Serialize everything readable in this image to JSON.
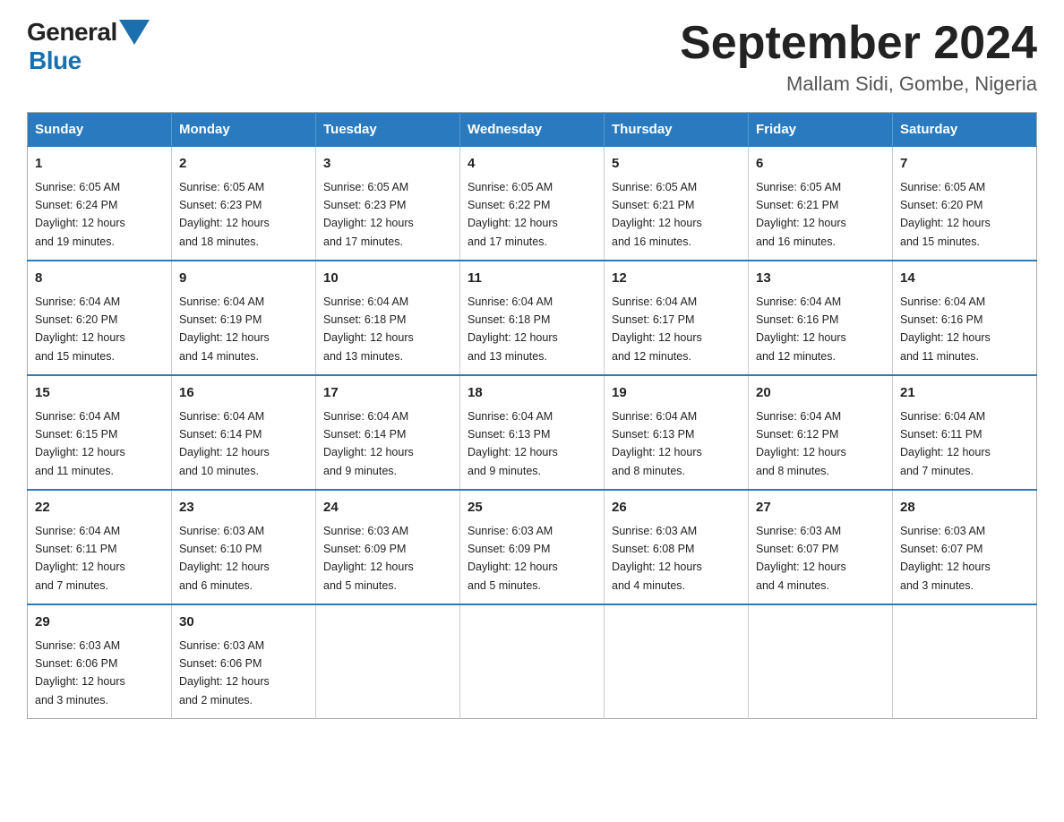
{
  "logo": {
    "text_general": "General",
    "text_blue": "Blue"
  },
  "title": {
    "month_year": "September 2024",
    "location": "Mallam Sidi, Gombe, Nigeria"
  },
  "weekdays": [
    "Sunday",
    "Monday",
    "Tuesday",
    "Wednesday",
    "Thursday",
    "Friday",
    "Saturday"
  ],
  "weeks": [
    [
      {
        "day": "1",
        "sunrise": "6:05 AM",
        "sunset": "6:24 PM",
        "daylight": "12 hours and 19 minutes."
      },
      {
        "day": "2",
        "sunrise": "6:05 AM",
        "sunset": "6:23 PM",
        "daylight": "12 hours and 18 minutes."
      },
      {
        "day": "3",
        "sunrise": "6:05 AM",
        "sunset": "6:23 PM",
        "daylight": "12 hours and 17 minutes."
      },
      {
        "day": "4",
        "sunrise": "6:05 AM",
        "sunset": "6:22 PM",
        "daylight": "12 hours and 17 minutes."
      },
      {
        "day": "5",
        "sunrise": "6:05 AM",
        "sunset": "6:21 PM",
        "daylight": "12 hours and 16 minutes."
      },
      {
        "day": "6",
        "sunrise": "6:05 AM",
        "sunset": "6:21 PM",
        "daylight": "12 hours and 16 minutes."
      },
      {
        "day": "7",
        "sunrise": "6:05 AM",
        "sunset": "6:20 PM",
        "daylight": "12 hours and 15 minutes."
      }
    ],
    [
      {
        "day": "8",
        "sunrise": "6:04 AM",
        "sunset": "6:20 PM",
        "daylight": "12 hours and 15 minutes."
      },
      {
        "day": "9",
        "sunrise": "6:04 AM",
        "sunset": "6:19 PM",
        "daylight": "12 hours and 14 minutes."
      },
      {
        "day": "10",
        "sunrise": "6:04 AM",
        "sunset": "6:18 PM",
        "daylight": "12 hours and 13 minutes."
      },
      {
        "day": "11",
        "sunrise": "6:04 AM",
        "sunset": "6:18 PM",
        "daylight": "12 hours and 13 minutes."
      },
      {
        "day": "12",
        "sunrise": "6:04 AM",
        "sunset": "6:17 PM",
        "daylight": "12 hours and 12 minutes."
      },
      {
        "day": "13",
        "sunrise": "6:04 AM",
        "sunset": "6:16 PM",
        "daylight": "12 hours and 12 minutes."
      },
      {
        "day": "14",
        "sunrise": "6:04 AM",
        "sunset": "6:16 PM",
        "daylight": "12 hours and 11 minutes."
      }
    ],
    [
      {
        "day": "15",
        "sunrise": "6:04 AM",
        "sunset": "6:15 PM",
        "daylight": "12 hours and 11 minutes."
      },
      {
        "day": "16",
        "sunrise": "6:04 AM",
        "sunset": "6:14 PM",
        "daylight": "12 hours and 10 minutes."
      },
      {
        "day": "17",
        "sunrise": "6:04 AM",
        "sunset": "6:14 PM",
        "daylight": "12 hours and 9 minutes."
      },
      {
        "day": "18",
        "sunrise": "6:04 AM",
        "sunset": "6:13 PM",
        "daylight": "12 hours and 9 minutes."
      },
      {
        "day": "19",
        "sunrise": "6:04 AM",
        "sunset": "6:13 PM",
        "daylight": "12 hours and 8 minutes."
      },
      {
        "day": "20",
        "sunrise": "6:04 AM",
        "sunset": "6:12 PM",
        "daylight": "12 hours and 8 minutes."
      },
      {
        "day": "21",
        "sunrise": "6:04 AM",
        "sunset": "6:11 PM",
        "daylight": "12 hours and 7 minutes."
      }
    ],
    [
      {
        "day": "22",
        "sunrise": "6:04 AM",
        "sunset": "6:11 PM",
        "daylight": "12 hours and 7 minutes."
      },
      {
        "day": "23",
        "sunrise": "6:03 AM",
        "sunset": "6:10 PM",
        "daylight": "12 hours and 6 minutes."
      },
      {
        "day": "24",
        "sunrise": "6:03 AM",
        "sunset": "6:09 PM",
        "daylight": "12 hours and 5 minutes."
      },
      {
        "day": "25",
        "sunrise": "6:03 AM",
        "sunset": "6:09 PM",
        "daylight": "12 hours and 5 minutes."
      },
      {
        "day": "26",
        "sunrise": "6:03 AM",
        "sunset": "6:08 PM",
        "daylight": "12 hours and 4 minutes."
      },
      {
        "day": "27",
        "sunrise": "6:03 AM",
        "sunset": "6:07 PM",
        "daylight": "12 hours and 4 minutes."
      },
      {
        "day": "28",
        "sunrise": "6:03 AM",
        "sunset": "6:07 PM",
        "daylight": "12 hours and 3 minutes."
      }
    ],
    [
      {
        "day": "29",
        "sunrise": "6:03 AM",
        "sunset": "6:06 PM",
        "daylight": "12 hours and 3 minutes."
      },
      {
        "day": "30",
        "sunrise": "6:03 AM",
        "sunset": "6:06 PM",
        "daylight": "12 hours and 2 minutes."
      },
      null,
      null,
      null,
      null,
      null
    ]
  ],
  "labels": {
    "sunrise": "Sunrise:",
    "sunset": "Sunset:",
    "daylight": "Daylight:"
  }
}
